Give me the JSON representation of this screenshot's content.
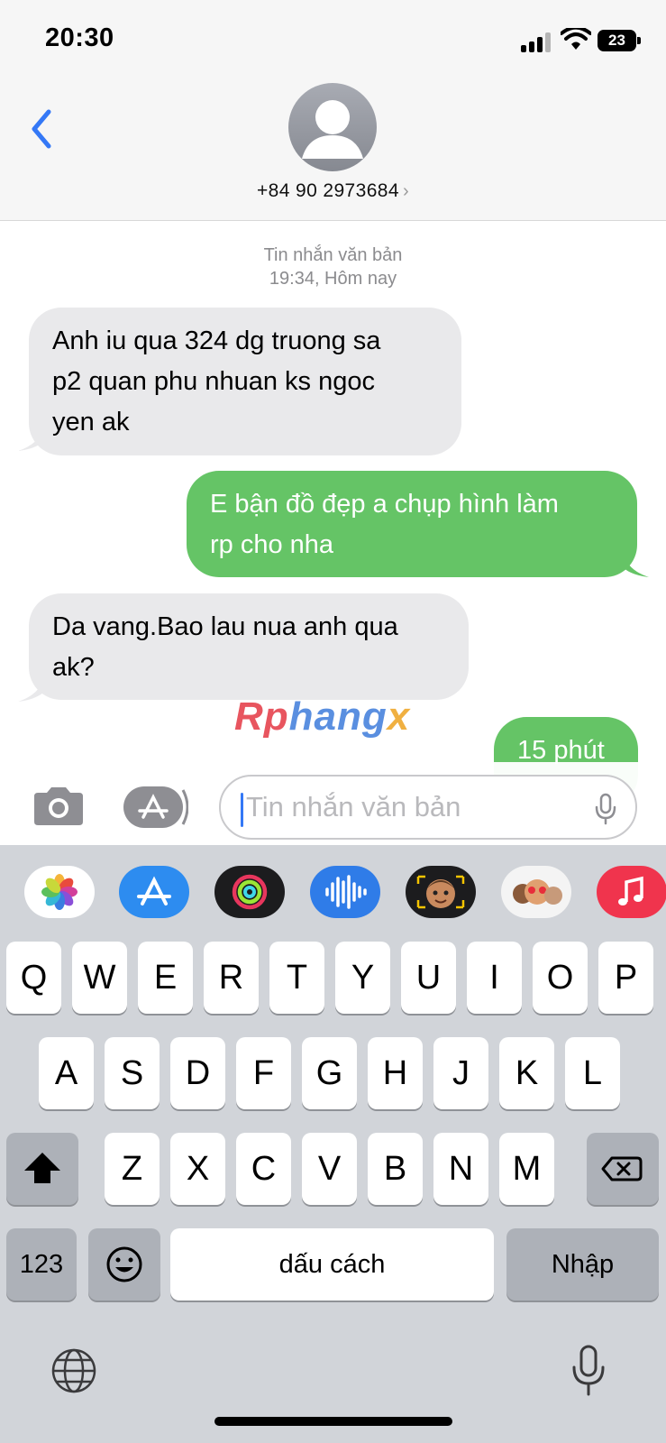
{
  "status_bar": {
    "time": "20:30",
    "battery": "23"
  },
  "header": {
    "contact": "+84 90 2973684",
    "chevron": "›"
  },
  "conversation": {
    "service_label": "Tin nhắn văn bản",
    "timestamp": "19:34, Hôm nay",
    "messages": [
      {
        "direction": "incoming",
        "lines": [
          "Anh iu qua 324 dg truong sa",
          "p2 quan phu nhuan ks ngoc",
          "yen ak"
        ]
      },
      {
        "direction": "outgoing",
        "lines": [
          "E bận đồ đẹp a chụp hình làm",
          "rp cho nha"
        ]
      },
      {
        "direction": "incoming",
        "lines": [
          "Da vang.Bao lau nua anh qua",
          "ak?"
        ]
      },
      {
        "direction": "outgoing",
        "lines": [
          "15 phút"
        ]
      }
    ]
  },
  "watermark": {
    "part1": "Rp",
    "part2": "hang",
    "part3": "x"
  },
  "input": {
    "placeholder": "Tin nhắn văn bản"
  },
  "app_strip": [
    "photos-icon",
    "app-store-icon",
    "activity-icon",
    "audio-message-icon",
    "memoji-icon",
    "memoji-stickers-icon",
    "music-icon"
  ],
  "keyboard": {
    "row1": [
      "Q",
      "W",
      "E",
      "R",
      "T",
      "Y",
      "U",
      "I",
      "O",
      "P"
    ],
    "row2": [
      "A",
      "S",
      "D",
      "F",
      "G",
      "H",
      "J",
      "K",
      "L"
    ],
    "row3": [
      "Z",
      "X",
      "C",
      "V",
      "B",
      "N",
      "M"
    ],
    "numbers_key": "123",
    "space_key": "dấu cách",
    "return_key": "Nhập"
  },
  "colors": {
    "outgoing_bubble": "#65c466",
    "incoming_bubble": "#e9e9eb",
    "accent": "#3478f6",
    "keyboard_bg": "#d1d4d9"
  }
}
